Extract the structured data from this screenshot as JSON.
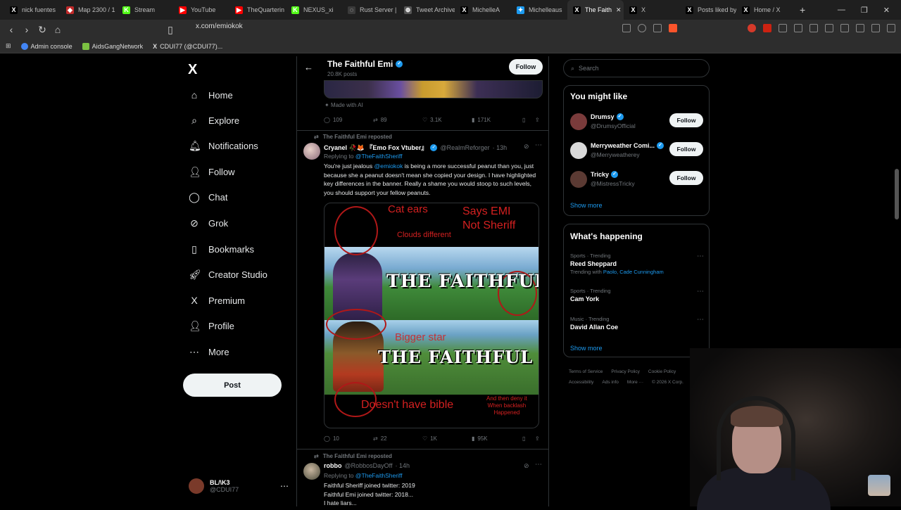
{
  "browser": {
    "tabs": [
      {
        "title": "nick fuentes",
        "color": "#000000",
        "glyph": "X"
      },
      {
        "title": "Map 2300 / 1",
        "color": "#c02a2a",
        "glyph": "◆"
      },
      {
        "title": "Stream",
        "color": "#53fc18",
        "glyph": "K"
      },
      {
        "title": "YouTube",
        "color": "#ff0000",
        "glyph": "▶"
      },
      {
        "title": "TheQuarterin",
        "color": "#ff0000",
        "glyph": "▶"
      },
      {
        "title": "NEXUS_xi",
        "color": "#53fc18",
        "glyph": "K"
      },
      {
        "title": "Rust Server |",
        "color": "#3a3a3a",
        "glyph": "◌"
      },
      {
        "title": "Tweet Archive",
        "color": "#555555",
        "glyph": "⊕"
      },
      {
        "title": "MichelleA",
        "color": "#000000",
        "glyph": "X"
      },
      {
        "title": "Michelleaus",
        "color": "#1d9bf0",
        "glyph": "✦"
      },
      {
        "title": "The Faith",
        "color": "#000000",
        "glyph": "X",
        "active": true
      },
      {
        "title": "X",
        "color": "#000000",
        "glyph": "X"
      },
      {
        "title": "Posts liked by",
        "color": "#000000",
        "glyph": "X"
      },
      {
        "title": "Home / X",
        "color": "#000000",
        "glyph": "X"
      }
    ],
    "url": "x.com/emiokok",
    "bookmarks": [
      {
        "label": "Admin console",
        "color": "#4285f4"
      },
      {
        "label": "AidsGangNetwork",
        "color": "#7cc142"
      },
      {
        "label": "CDUI77 (@CDUI77)...",
        "color": "#000000"
      }
    ]
  },
  "nav": {
    "logo": "X",
    "items": [
      {
        "label": "Home",
        "icon": "home-icon",
        "glyph": "⌂"
      },
      {
        "label": "Explore",
        "icon": "search-icon",
        "glyph": "⌕"
      },
      {
        "label": "Notifications",
        "icon": "bell-icon",
        "glyph": "🔔︎"
      },
      {
        "label": "Follow",
        "icon": "person-plus-icon",
        "glyph": "👤︎"
      },
      {
        "label": "Chat",
        "icon": "chat-icon",
        "glyph": "◯"
      },
      {
        "label": "Grok",
        "icon": "grok-icon",
        "glyph": "⊘"
      },
      {
        "label": "Bookmarks",
        "icon": "bookmark-icon",
        "glyph": "▯"
      },
      {
        "label": "Creator Studio",
        "icon": "rocket-icon",
        "glyph": "🚀︎"
      },
      {
        "label": "Premium",
        "icon": "x-premium-icon",
        "glyph": "X"
      },
      {
        "label": "Profile",
        "icon": "profile-icon",
        "glyph": "👤︎"
      },
      {
        "label": "More",
        "icon": "more-circle-icon",
        "glyph": "⋯"
      }
    ],
    "post_label": "Post",
    "account_name": "BL/\\K3",
    "account_handle": "@CDUI77"
  },
  "main": {
    "header": {
      "title": "The Faithful Emi",
      "posts": "20.8K posts",
      "follow_label": "Follow"
    },
    "prev_tweet": {
      "made_with_ai": "Made with AI",
      "replies": "109",
      "reposts": "89",
      "likes": "3.1K",
      "views": "171K"
    },
    "tweet1": {
      "repost_by": "The Faithful Emi reposted",
      "name": "Cryanel 🥀🦊 『Emo Fox Vtuber』",
      "handle": "@RealmReforger",
      "time": "· 13h",
      "replying_prefix": "Replying to",
      "replying_to": "@TheFaithSheriff",
      "text_a": "You're just jealous",
      "text_mention": "@emiokok",
      "text_b": "is being a more successful peanut than you, just because she a peanut doesn't mean she copied your design. I have highlighted key differences in the banner. Really a shame you would stoop to such levels, you should support your fellow peanuts.",
      "meme": {
        "cat_ears": "Cat ears",
        "says": "Says EMI\nNot Sheriff",
        "clouds": "Clouds different",
        "title1": "THE FAITHFUL EMI",
        "title2": "THE FAITHFUL SHERIFF",
        "bigger_star": "Bigger star",
        "bible": "Doesn't have bible",
        "deny": "And then deny it\nWhen backlash\nHappened"
      },
      "replies": "10",
      "reposts": "22",
      "likes": "1K",
      "views": "95K"
    },
    "tweet2": {
      "repost_by": "The Faithful Emi reposted",
      "name": "robbo",
      "handle": "@RobbosDayOff",
      "time": "· 14h",
      "replying_prefix": "Replying to",
      "replying_to": "@TheFaithSheriff",
      "line1": "Faithful Sheriff joined twitter: 2019",
      "line2": "Faithful Emi joined twitter: 2018...",
      "line3": "I hate liars..."
    }
  },
  "right": {
    "search_placeholder": "Search",
    "you_might_like": "You might like",
    "suggestions": [
      {
        "name": "Drumsy",
        "handle": "@DrumsyOfficial",
        "verified": true,
        "color": "#7a3b3b"
      },
      {
        "name": "Merryweather Comi...",
        "handle": "@Merryweatherey",
        "verified": true,
        "color": "#d9d9d9"
      },
      {
        "name": "Tricky",
        "handle": "@MistressTricky",
        "verified": true,
        "color": "#5b3a33"
      }
    ],
    "follow_label": "Follow",
    "show_more": "Show more",
    "whats_happening": "What's happening",
    "trends": [
      {
        "category": "Sports · Trending",
        "title": "Reed Sheppard",
        "with_prefix": "Trending with",
        "with": "Paolo, Cade Cunningham"
      },
      {
        "category": "Sports · Trending",
        "title": "Cam York"
      },
      {
        "category": "Music · Trending",
        "title": "David Allan Coe"
      }
    ],
    "footer": [
      "Terms of Service",
      "Privacy Policy",
      "Cookie Policy",
      "Accessibility",
      "Ads info",
      "More ···",
      "© 2026 X Corp."
    ]
  }
}
